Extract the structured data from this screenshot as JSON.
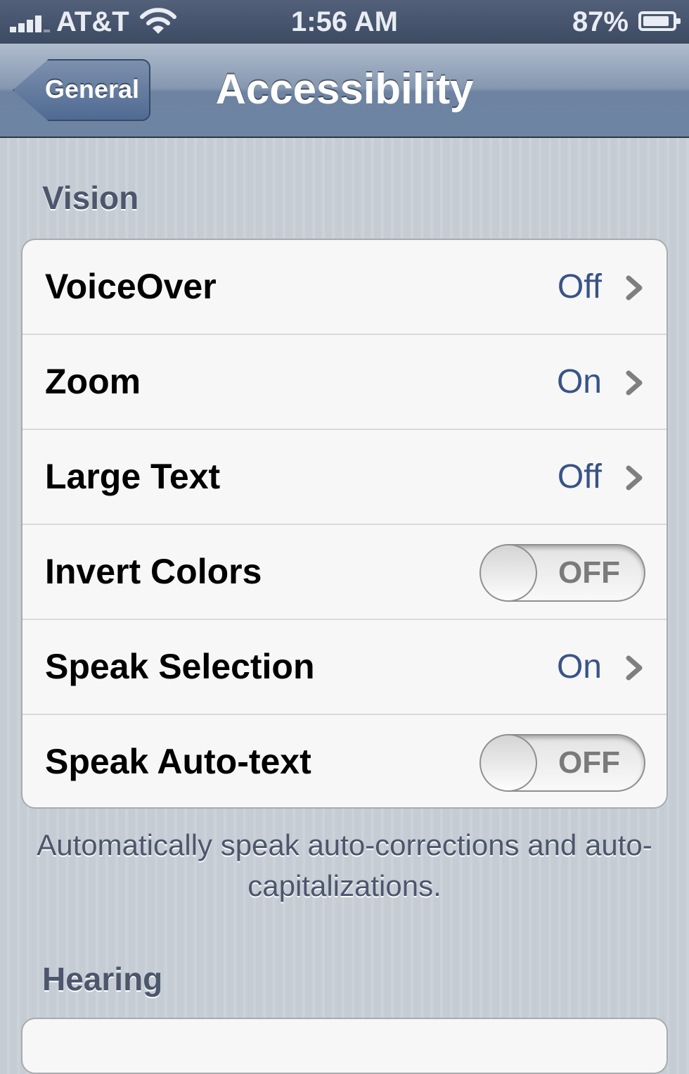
{
  "status_bar": {
    "carrier": "AT&T",
    "time": "1:56 AM",
    "battery_percent": "87%",
    "battery_level": 0.87,
    "icons": [
      "signal-bars-icon",
      "wifi-icon",
      "battery-icon"
    ]
  },
  "nav_bar": {
    "back_label": "General",
    "title": "Accessibility"
  },
  "sections": {
    "vision": {
      "header": "Vision",
      "rows": [
        {
          "label": "VoiceOver",
          "value": "Off"
        },
        {
          "label": "Zoom",
          "value": "On"
        },
        {
          "label": "Large Text",
          "value": "Off"
        },
        {
          "label": "Invert Colors",
          "toggle": "OFF"
        },
        {
          "label": "Speak Selection",
          "value": "On"
        },
        {
          "label": "Speak Auto-text",
          "toggle": "OFF"
        }
      ],
      "footer": "Automatically speak auto-corrections and auto-capitalizations."
    },
    "hearing": {
      "header": "Hearing"
    }
  },
  "colors": {
    "detail_blue": "#385487",
    "section_header": "#4c566c",
    "nav_bar": "#6d84a2",
    "background": "#c5ccd4"
  }
}
